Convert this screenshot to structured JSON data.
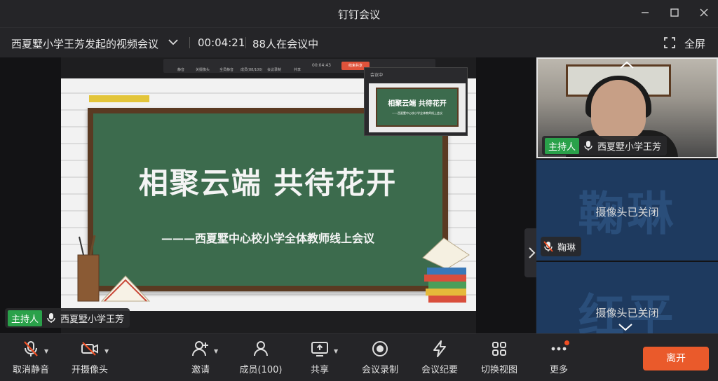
{
  "window": {
    "title": "钉钉会议"
  },
  "info": {
    "meeting_name": "西夏墅小学王芳发起的视频会议",
    "timer": "00:04:21",
    "participants": "88人在会议中",
    "fullscreen_label": "全屏"
  },
  "share": {
    "mini_toolbar": [
      "静音",
      "关摄像头",
      "全员静音",
      "成员(88/100)",
      "会议录制",
      "共享",
      "00:04:43"
    ],
    "mini_end_label": "结束共享",
    "slide_title": "相聚云端   共待花开",
    "slide_subtitle": "———西夏墅中心校小学全体教师线上会议",
    "pip_title": "相聚云端   共待花开",
    "pip_subtitle": "——西夏墅中心校小学全体教师线上会议",
    "host_badge": "主持人",
    "host_name": "西夏墅小学王芳"
  },
  "participants": [
    {
      "host_badge": "主持人",
      "name": "西夏墅小学王芳",
      "camera": "on"
    },
    {
      "name": "鞠琳",
      "big_name": "鞠琳",
      "status": "摄像头已关闭",
      "muted": true
    },
    {
      "big_name": "红平",
      "status": "摄像头已关闭"
    }
  ],
  "toolbar": {
    "unmute": "取消静音",
    "camera": "开摄像头",
    "invite": "邀请",
    "members": "成员(100)",
    "share": "共享",
    "record": "会议录制",
    "minutes": "会议纪要",
    "switch_view": "切换视图",
    "more": "更多",
    "leave": "离开"
  },
  "colors": {
    "host_green": "#2aa14a",
    "leave_orange": "#ea5a2b",
    "board_green": "#3c6b4d",
    "tile_blue": "#1e3a5f"
  }
}
